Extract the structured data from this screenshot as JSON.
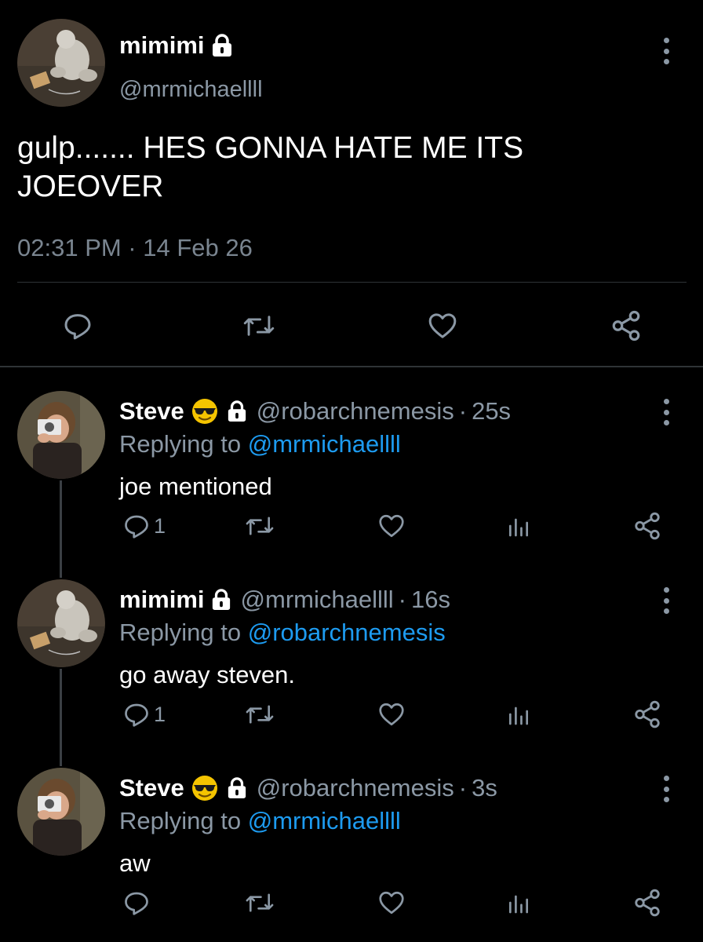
{
  "main_tweet": {
    "display_name": "mimimi",
    "handle": "@mrmichaellll",
    "text": "gulp....... HES GONNA HATE ME ITS JOEOVER",
    "timestamp": "02:31 PM · 14 Feb 26",
    "actions": [
      "reply-icon",
      "retweet-icon",
      "like-icon",
      "share-icon"
    ]
  },
  "replies": [
    {
      "display_name": "Steve",
      "emoji": "😎",
      "handle": "@robarchnemesis",
      "separator": "·",
      "time": "25s",
      "replying_prefix": "Replying to",
      "replying_to": "@mrmichaellll",
      "text": "joe mentioned",
      "reply_count": "1"
    },
    {
      "display_name": "mimimi",
      "emoji": "",
      "handle": "@mrmichaellll",
      "separator": "·",
      "time": "16s",
      "replying_prefix": "Replying to",
      "replying_to": "@robarchnemesis",
      "text": "go away steven.",
      "reply_count": "1"
    },
    {
      "display_name": "Steve",
      "emoji": "😎",
      "handle": "@robarchnemesis",
      "separator": "·",
      "time": "3s",
      "replying_prefix": "Replying to",
      "replying_to": "@mrmichaellll",
      "text": "aw",
      "reply_count": ""
    }
  ],
  "colors": {
    "background": "#000000",
    "text": "#ffffff",
    "secondary": "#8b98a5",
    "link": "#1d9bf0",
    "divider": "#2f3336",
    "emoji": "#f5c400"
  }
}
